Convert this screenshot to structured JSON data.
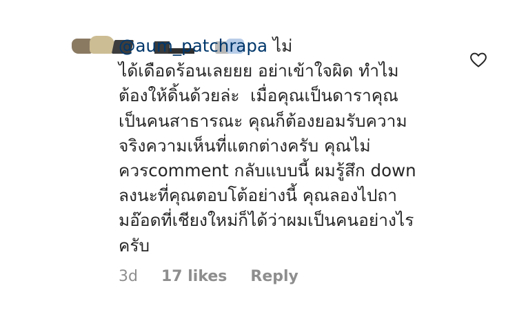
{
  "comment": {
    "mention": "@aum_patchrapa",
    "lines": [
      " ไม่",
      "ได้เดือดร้อนเลยยย อย่าเข้าใจผิด ทำไม",
      "ต้องให้ดิ้นด้วยล่ะ  เมื่อคุณเป็นดาราคุณ",
      "เป็นคนสาธารณะ คุณก็ต้องยอมรับความ",
      "จริงความเห็นที่แตกต่างครับ คุณไม่",
      "ควรcomment กลับแบบนี้ ผมรู้สึก down",
      "ลงนะที่คุณตอบโต้อย่างนี้ คุณลองไปถา",
      "มอ๊อดที่เชียงใหม่ก็ได้ว่าผมเป็นคนอย่างไร",
      "ครับ"
    ],
    "time": "3d",
    "likes": "17 likes",
    "reply_label": "Reply",
    "like_icon": "heart-outline-icon"
  },
  "colors": {
    "text": "#262626",
    "mention": "#00376b",
    "meta": "#8e8e8e"
  }
}
